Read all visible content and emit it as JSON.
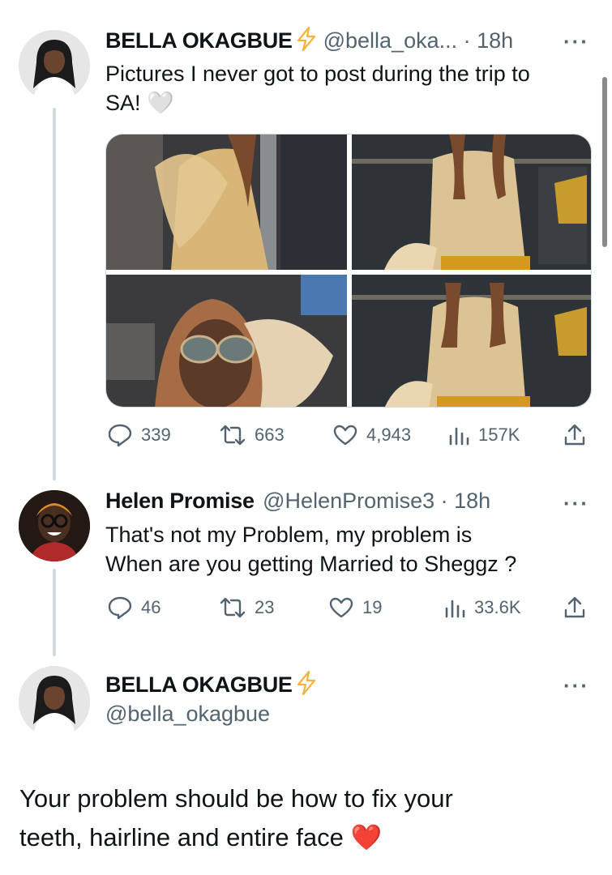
{
  "tweet1": {
    "name": "BELLA OKAGBUE",
    "handle_time": "@bella_oka... · 18h",
    "text_line1": "Pictures I never got to post during the trip to",
    "text_line2": "SA!",
    "emoji": "🤍",
    "stats": {
      "replies": "339",
      "retweets": "663",
      "likes": "4,943",
      "views": "157K"
    }
  },
  "tweet2": {
    "name": "Helen Promise",
    "handle_time": "@HelenPromise3 · 18h",
    "text_line1": "That's not my Problem, my problem is",
    "text_line2": "When are you getting Married to Sheggz ?",
    "stats": {
      "replies": "46",
      "retweets": "23",
      "likes": "19",
      "views": "33.6K"
    }
  },
  "tweet3": {
    "name": "BELLA OKAGBUE",
    "handle": "@bella_okagbue",
    "text_line1": "Your problem should be how to fix your",
    "text_line2": "teeth, hairline and entire face",
    "emoji": "❤️"
  },
  "more_label": "···",
  "colors": {
    "verified": "#f5b33a",
    "secondary_text": "#536471",
    "thread_line": "#cfd9de",
    "heart": "#e0242a"
  }
}
